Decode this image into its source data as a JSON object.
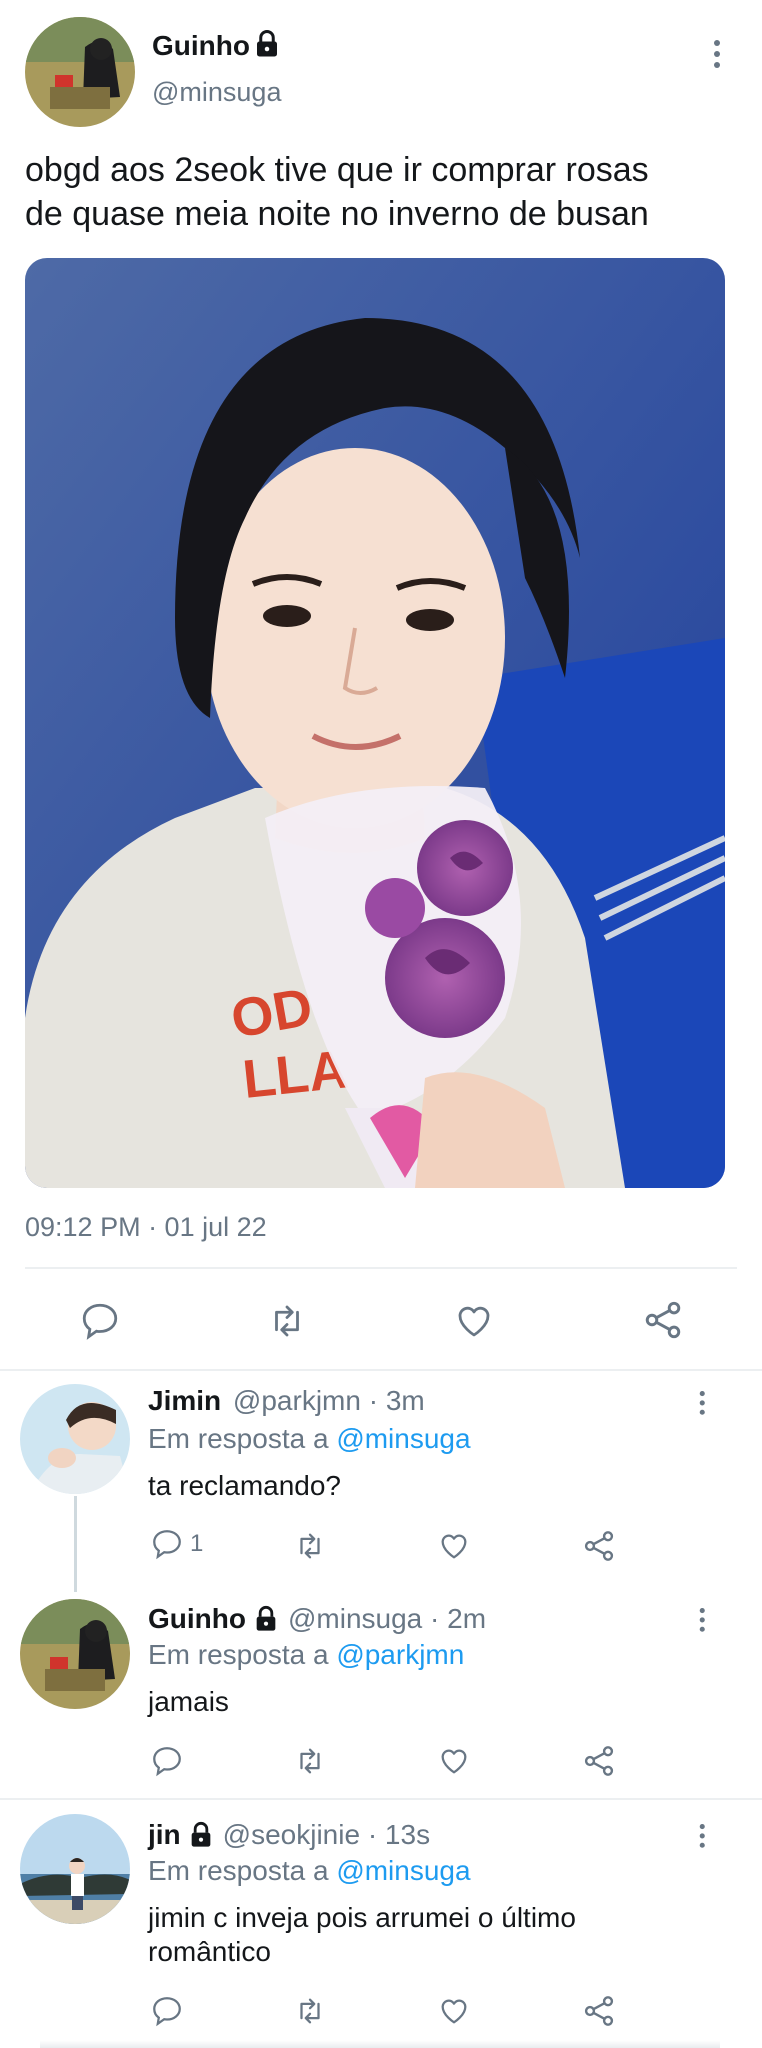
{
  "main_tweet": {
    "display_name": "Guinho",
    "handle": "@minsuga",
    "text_line1": "obgd aos 2seok tive que ir comprar rosas",
    "text_line2": "de quase meia noite no inverno de busan",
    "timestamp": "09:12 PM · 01 jul 22",
    "media_description": "selfie photo holding a bouquet of pink roses"
  },
  "replies": [
    {
      "display_name": "Jimin",
      "meta": "@parkjmn · 3m",
      "reply_prefix": "Em resposta a",
      "reply_to": "@minsuga",
      "text": "ta reclamando?",
      "reply_count": "1"
    },
    {
      "display_name": "Guinho",
      "meta": "@minsuga · 2m",
      "reply_prefix": "Em resposta a",
      "reply_to": "@parkjmn",
      "text": "jamais",
      "reply_count": ""
    },
    {
      "display_name": "jin",
      "meta": "@seokjinie · 13s",
      "reply_prefix": "Em resposta a",
      "reply_to": "@minsuga",
      "text_line1": "jimin c inveja pois arrumei o último",
      "text_line2": "romântico",
      "reply_count": ""
    }
  ],
  "colors": {
    "accent": "#1d9bf0",
    "muted": "#687684",
    "divider": "#eceff1"
  }
}
